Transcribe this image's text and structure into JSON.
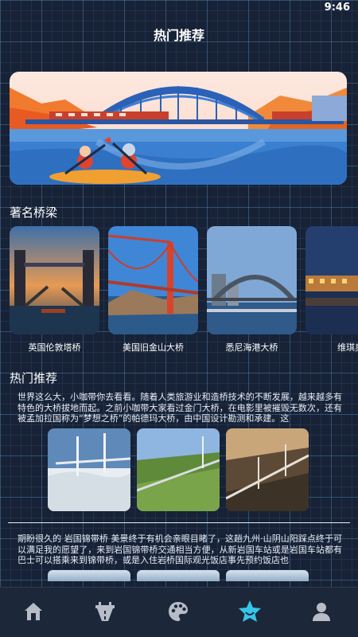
{
  "status_bar": {
    "time": "9:46"
  },
  "header": {
    "title": "热门推荐"
  },
  "banner": {
    "illustration": "bridge-kayak-illustration"
  },
  "famous_bridges": {
    "title": "著名桥梁",
    "items": [
      {
        "label": "英国伦敦塔桥",
        "icon": "tower-bridge-photo"
      },
      {
        "label": "美国旧金山大桥",
        "icon": "golden-gate-photo"
      },
      {
        "label": "悉尼海港大桥",
        "icon": "sydney-harbour-photo"
      },
      {
        "label": "维琪奥",
        "icon": "ponte-vecchio-photo"
      }
    ]
  },
  "recommend": {
    "title": "热门推荐",
    "article1": "世界这么大，小咖带你去看看。随着人类旅游业和造桥技术的不断发展，越来越多有特色的大桥拔地而起。之前小咖带大家看过金门大桥，在电影里被摧毁无数次，还有被孟加拉国称为“梦想之桥”的帕德玛大桥，由中国设计勘测和承建。这",
    "article2": "期盼很久的 岩国锦带桥 美景终于有机会亲眼目睹了，这趟九州·山阴山阳踩点终于可以满足我的愿望了，来到岩国锦带桥交通相当方便，从新岩国车站或是岩国车站都有巴士可以搭乘来到锦带桥，或是入住岩桥国际观光饭店事先预约饭店也"
  },
  "tab_bar": {
    "active_color": "#36c5e8",
    "inactive_color": "#b7bcc6",
    "tabs": [
      {
        "icon": "home-icon"
      },
      {
        "icon": "road-icon"
      },
      {
        "icon": "palette-icon"
      },
      {
        "icon": "star-icon"
      },
      {
        "icon": "profile-icon"
      }
    ]
  }
}
